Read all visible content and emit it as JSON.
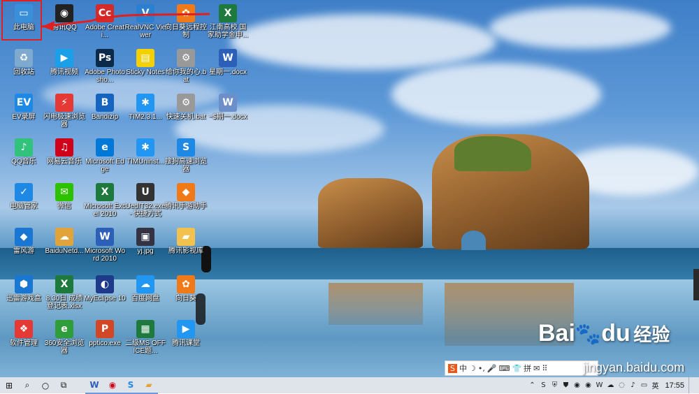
{
  "desktop": {
    "icons": [
      {
        "label": "此电脑",
        "icon": "computer-icon",
        "color": "#3a8fd9",
        "glyph": "▭"
      },
      {
        "label": "腾讯QQ",
        "icon": "qq-icon",
        "color": "#222",
        "glyph": "◉"
      },
      {
        "label": "Adobe Creati...",
        "icon": "adobe-cc-icon",
        "color": "#d42a2a",
        "glyph": "Cc"
      },
      {
        "label": "RealVNC Viewer",
        "icon": "realvnc-icon",
        "color": "#2b7fd0",
        "glyph": "V"
      },
      {
        "label": "向日葵远程控制",
        "icon": "sunflower-icon",
        "color": "#f07a18",
        "glyph": "✿"
      },
      {
        "label": "江南高校 国家助学金申...",
        "icon": "excel-file-icon",
        "color": "#1e7a3c",
        "glyph": "X"
      },
      {
        "label": "回收站",
        "icon": "recycle-bin-icon",
        "color": "#7fa9cf",
        "glyph": "♻"
      },
      {
        "label": "腾讯视频",
        "icon": "tencent-video-icon",
        "color": "#1aa0e8",
        "glyph": "▶"
      },
      {
        "label": "Adobe Photosho...",
        "icon": "photoshop-icon",
        "color": "#0b2a4a",
        "glyph": "Ps"
      },
      {
        "label": "Sticky Notes",
        "icon": "sticky-notes-icon",
        "color": "#f4d000",
        "glyph": "▤"
      },
      {
        "label": "给你我的心.bat",
        "icon": "bat-file-icon",
        "color": "#999",
        "glyph": "⚙"
      },
      {
        "label": "星期一.docx",
        "icon": "word-doc-icon",
        "color": "#2b5fb8",
        "glyph": "W"
      },
      {
        "label": "EV录屏",
        "icon": "ev-recorder-icon",
        "color": "#1e88e5",
        "glyph": "EV"
      },
      {
        "label": "闪电极速浏览器",
        "icon": "browser-icon",
        "color": "#e53935",
        "glyph": "⚡"
      },
      {
        "label": "Bandizip",
        "icon": "bandizip-icon",
        "color": "#1565c0",
        "glyph": "B"
      },
      {
        "label": "TIM2.3.1...",
        "icon": "tim-icon",
        "color": "#2196f3",
        "glyph": "✱"
      },
      {
        "label": "快速关机.bat",
        "icon": "bat-file-icon",
        "color": "#999",
        "glyph": "⚙"
      },
      {
        "label": "~$期一.docx",
        "icon": "word-temp-icon",
        "color": "#6d8fc9",
        "glyph": "W"
      },
      {
        "label": "QQ音乐",
        "icon": "qq-music-icon",
        "color": "#31c27c",
        "glyph": "♪"
      },
      {
        "label": "网易云音乐",
        "icon": "netease-music-icon",
        "color": "#d0021b",
        "glyph": "♫"
      },
      {
        "label": "Microsoft Edge",
        "icon": "edge-icon",
        "color": "#0078d7",
        "glyph": "e"
      },
      {
        "label": "TIMUninst...",
        "icon": "tim-uninstall-icon",
        "color": "#2196f3",
        "glyph": "✱"
      },
      {
        "label": "搜狗高速浏览器",
        "icon": "sogou-browser-icon",
        "color": "#1e88e5",
        "glyph": "S"
      },
      {
        "label": "",
        "icon": "",
        "color": "",
        "glyph": ""
      },
      {
        "label": "电脑管家",
        "icon": "pc-manager-icon",
        "color": "#1e88e5",
        "glyph": "✓"
      },
      {
        "label": "微信",
        "icon": "wechat-icon",
        "color": "#2dc100",
        "glyph": "✉"
      },
      {
        "label": "Microsoft Excel 2010",
        "icon": "excel-icon",
        "color": "#1e7a3c",
        "glyph": "X"
      },
      {
        "label": "UedIT32.exe - 快捷方式",
        "icon": "uedit-icon",
        "color": "#333",
        "glyph": "U"
      },
      {
        "label": "腾讯手游助手",
        "icon": "game-assistant-icon",
        "color": "#f07a18",
        "glyph": "◆"
      },
      {
        "label": "",
        "icon": "",
        "color": "",
        "glyph": ""
      },
      {
        "label": "雷风游",
        "icon": "game-icon",
        "color": "#1976d2",
        "glyph": "◆"
      },
      {
        "label": "BaiduNetd...",
        "icon": "baidu-netdisk-icon",
        "color": "#e0a43a",
        "glyph": "☁"
      },
      {
        "label": "Microsoft Word 2010",
        "icon": "word-icon",
        "color": "#2b5fb8",
        "glyph": "W"
      },
      {
        "label": "yj.jpg",
        "icon": "image-file-icon",
        "color": "#334",
        "glyph": "▣"
      },
      {
        "label": "腾讯影视库",
        "icon": "folder-icon",
        "color": "#f2c14e",
        "glyph": "▰"
      },
      {
        "label": "",
        "icon": "",
        "color": "",
        "glyph": ""
      },
      {
        "label": "迅雷游戏盒",
        "icon": "game-box-icon",
        "color": "#1976d2",
        "glyph": "⬢"
      },
      {
        "label": "8.30日 成绩登记表.xlsx",
        "icon": "excel-file-icon",
        "color": "#1e7a3c",
        "glyph": "X"
      },
      {
        "label": "MyEclipse 10",
        "icon": "myeclipse-icon",
        "color": "#1f3a8a",
        "glyph": "◐"
      },
      {
        "label": "百度网盘",
        "icon": "baidu-disk-icon",
        "color": "#2196f3",
        "glyph": "☁"
      },
      {
        "label": "向日葵",
        "icon": "sunflower-icon",
        "color": "#f07a18",
        "glyph": "✿"
      },
      {
        "label": "",
        "icon": "",
        "color": "",
        "glyph": ""
      },
      {
        "label": "软件管理",
        "icon": "software-manager-icon",
        "color": "#e53935",
        "glyph": "❖"
      },
      {
        "label": "360安全浏览器",
        "icon": "360-browser-icon",
        "color": "#2e9d3a",
        "glyph": "e"
      },
      {
        "label": "pptico.exe",
        "icon": "ppt-icon",
        "color": "#d24726",
        "glyph": "P"
      },
      {
        "label": "二级MS OFFICE题...",
        "icon": "office-icon",
        "color": "#1e7a3c",
        "glyph": "▦"
      },
      {
        "label": "腾讯课堂",
        "icon": "tencent-class-icon",
        "color": "#2196f3",
        "glyph": "▶"
      }
    ]
  },
  "ime_bar": {
    "items": [
      "S",
      "中",
      "☽",
      "•,",
      "🎤",
      "⌨",
      "👕",
      "拼",
      "✉",
      "⠿"
    ]
  },
  "watermark": {
    "brand": "Bai",
    "brand2": "du",
    "jingyan": "经验",
    "url": "jingyan.baidu.com"
  },
  "taskbar": {
    "start_glyph": "⊞",
    "search_glyph": "⌕",
    "cortana_glyph": "○",
    "taskview_glyph": "⧉",
    "pinned": [
      {
        "glyph": "W",
        "name": "taskbar-word-icon",
        "color": "#2b5fb8"
      },
      {
        "glyph": "◉",
        "name": "taskbar-netease-icon",
        "color": "#d0021b"
      },
      {
        "glyph": "S",
        "name": "taskbar-sogou-icon",
        "color": "#1e88e5"
      },
      {
        "glyph": "▰",
        "name": "taskbar-explorer-icon",
        "color": "#e0a43a"
      }
    ],
    "tray": [
      {
        "glyph": "⌃",
        "name": "tray-overflow-icon"
      },
      {
        "glyph": "S",
        "name": "tray-sogou-icon"
      },
      {
        "glyph": "⛨",
        "name": "tray-security-icon"
      },
      {
        "glyph": "⛊",
        "name": "tray-defender-icon"
      },
      {
        "glyph": "◉",
        "name": "tray-netease-icon"
      },
      {
        "glyph": "◉",
        "name": "tray-music-icon"
      },
      {
        "glyph": "W",
        "name": "tray-wps-icon"
      },
      {
        "glyph": "☁",
        "name": "tray-cloud-icon"
      },
      {
        "glyph": "◌",
        "name": "tray-wifi-icon"
      },
      {
        "glyph": "♪",
        "name": "tray-volume-icon"
      },
      {
        "glyph": "▭",
        "name": "tray-battery-icon"
      },
      {
        "glyph": "英",
        "name": "tray-language-icon"
      }
    ],
    "clock": "17:55"
  }
}
